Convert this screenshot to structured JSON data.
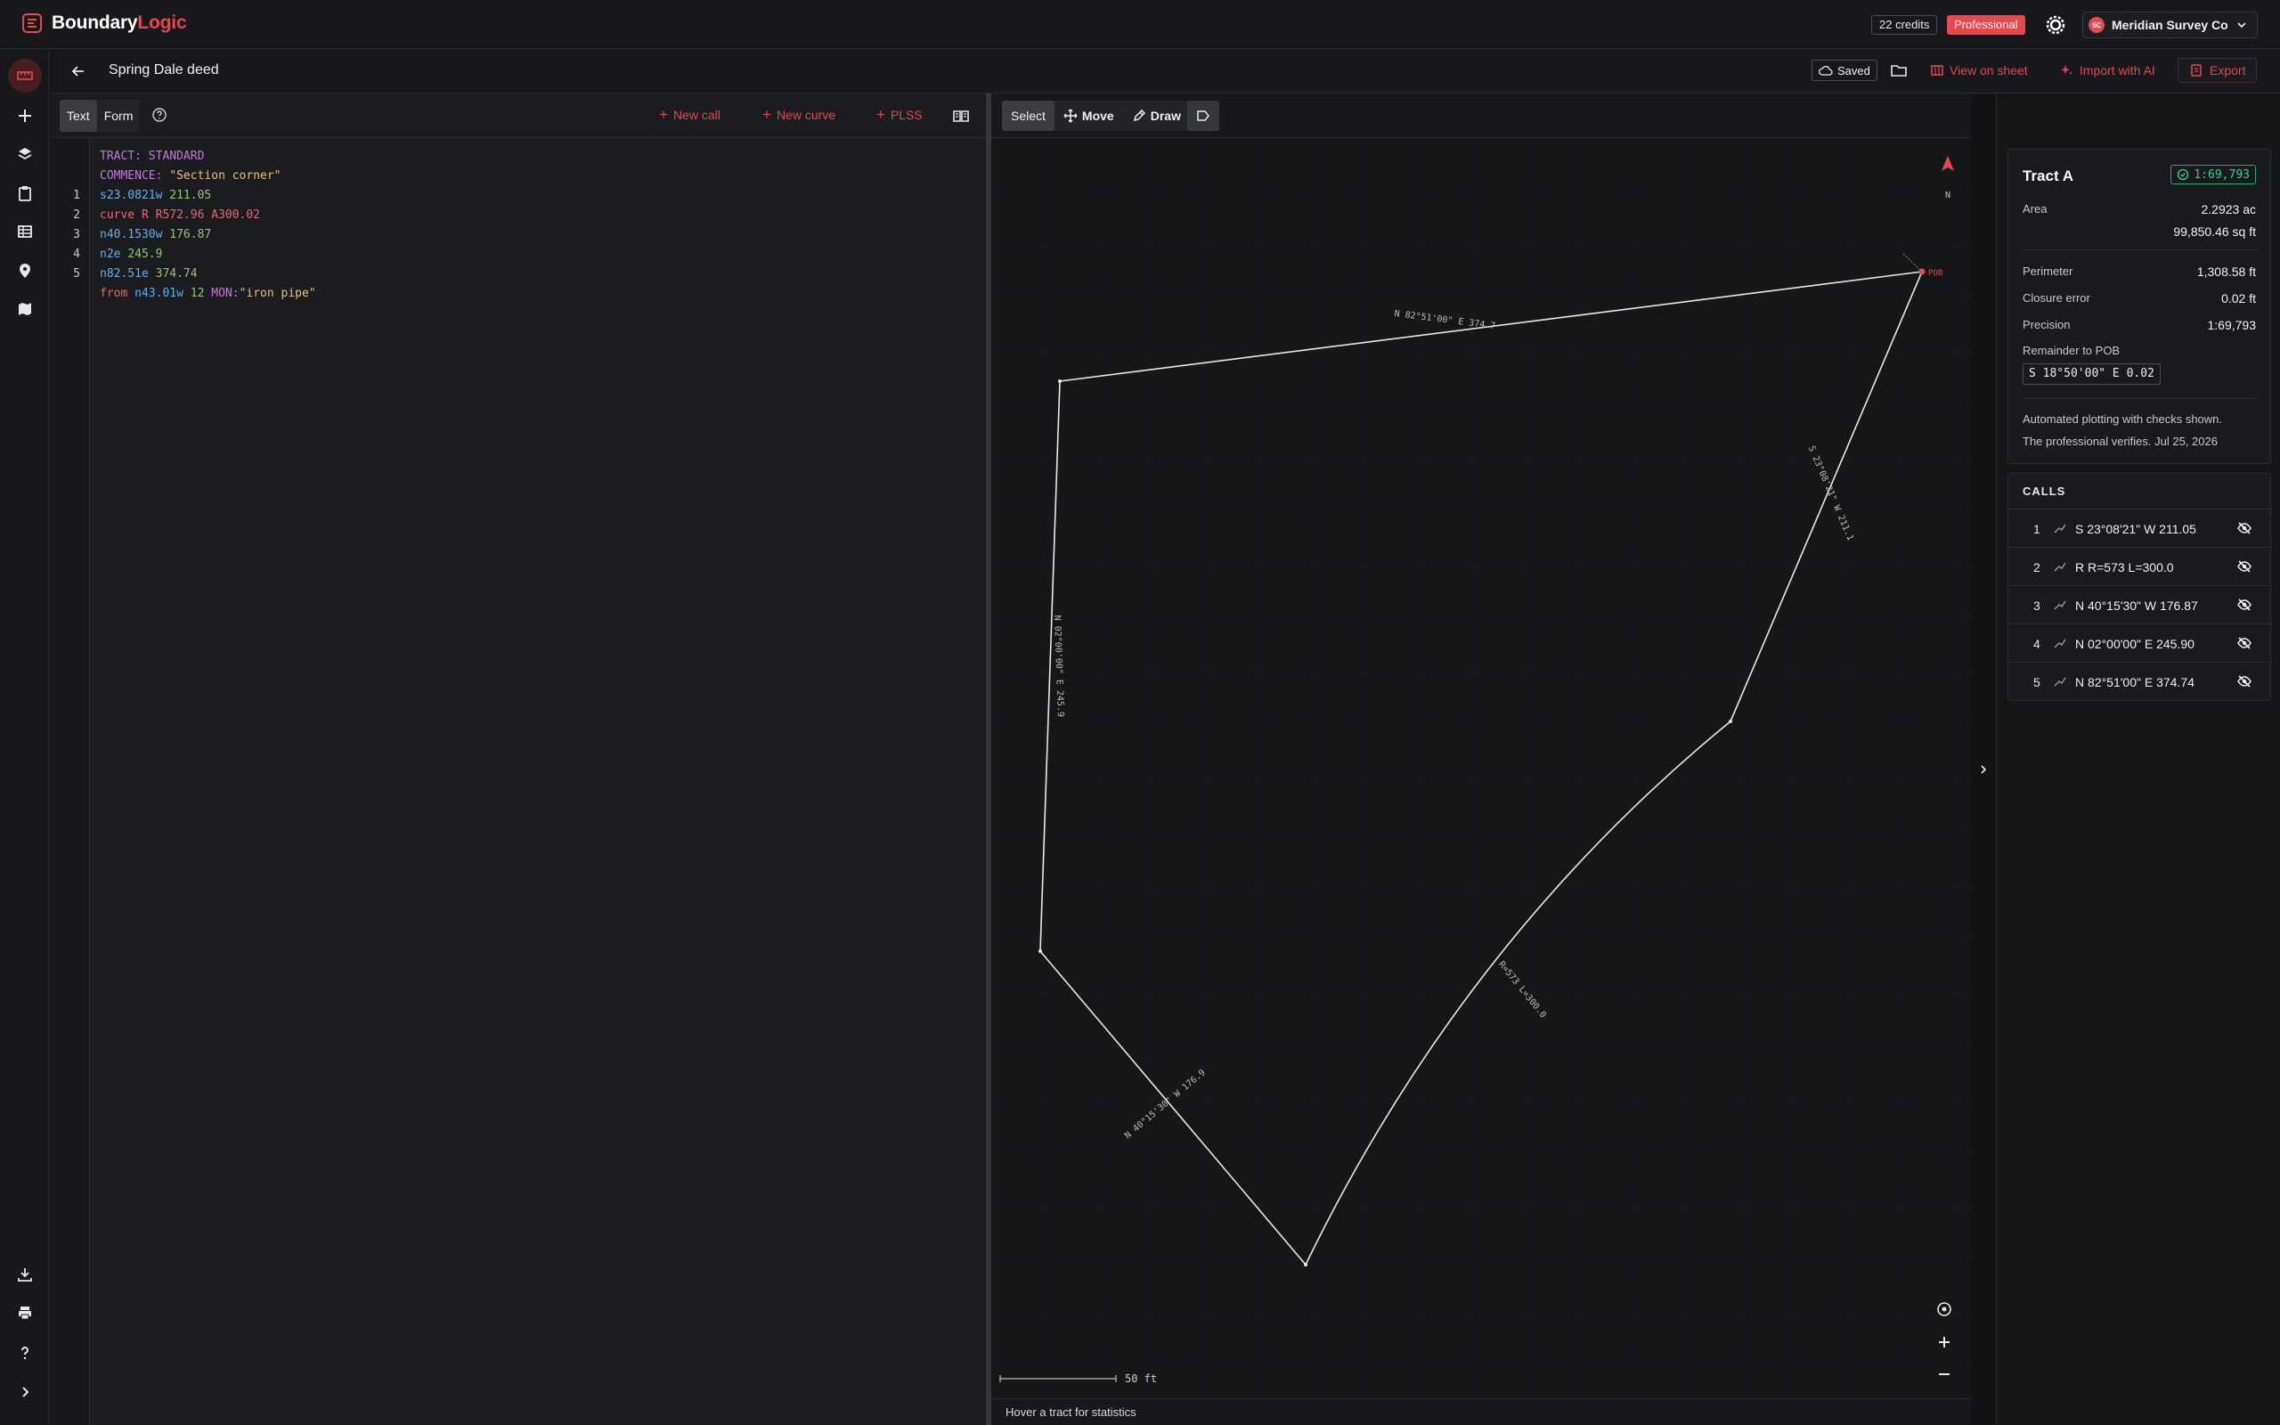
{
  "colors": {
    "accent": "#e5484d",
    "success": "#3ecf8e",
    "background": "#111315",
    "line": "#e8e8e8"
  },
  "topbar": {
    "brand_prefix": "Boundary",
    "brand_suffix": "Logic",
    "credits": "22 credits",
    "plan": "Professional",
    "org_initials": "SC",
    "org_name": "Meridian Survey Co"
  },
  "rail": {
    "top_icons": [
      "ruler-icon",
      "plus-icon",
      "layers-icon",
      "clipboard-icon",
      "table-icon",
      "location-pin-icon",
      "map-icon"
    ],
    "bottom_icons": [
      "download-icon",
      "print-icon",
      "help-icon",
      "chevron-right-icon"
    ]
  },
  "doc": {
    "title": "Spring Dale deed",
    "saved": "Saved",
    "view_on_sheet": "View on sheet",
    "import_ai": "Import with AI",
    "export": "Export"
  },
  "editor": {
    "tabs": [
      {
        "label": "Text",
        "active": true
      },
      {
        "label": "Form",
        "active": false
      }
    ],
    "new_call": "New call",
    "new_curve": "New curve",
    "plss": "PLSS",
    "lines": [
      {
        "num": "",
        "tokens": [
          {
            "t": "TRACT: STANDARD",
            "c": "#c678dd"
          }
        ]
      },
      {
        "num": "",
        "tokens": [
          {
            "t": "COMMENCE: ",
            "c": "#c678dd"
          },
          {
            "t": "\"Section corner\"",
            "c": "#e5c07b"
          }
        ]
      },
      {
        "num": "1",
        "tokens": [
          {
            "t": "s23.0821w ",
            "c": "#61afef"
          },
          {
            "t": "211.05",
            "c": "#98c379"
          }
        ]
      },
      {
        "num": "2",
        "tokens": [
          {
            "t": "curve R R572.96 A300.02",
            "c": "#e06c75"
          }
        ]
      },
      {
        "num": "3",
        "tokens": [
          {
            "t": "n40.1530w ",
            "c": "#61afef"
          },
          {
            "t": "176.87",
            "c": "#98c379"
          }
        ]
      },
      {
        "num": "4",
        "tokens": [
          {
            "t": "n2e ",
            "c": "#61afef"
          },
          {
            "t": "245.9",
            "c": "#98c379"
          }
        ]
      },
      {
        "num": "5",
        "tokens": [
          {
            "t": "n82.51e ",
            "c": "#61afef"
          },
          {
            "t": "374.74",
            "c": "#98c379"
          }
        ]
      },
      {
        "num": "",
        "tokens": [
          {
            "t": "from ",
            "c": "#e06c75"
          },
          {
            "t": "n43.01w ",
            "c": "#61afef"
          },
          {
            "t": "12 ",
            "c": "#98c379"
          },
          {
            "t": "MON:",
            "c": "#c678dd"
          },
          {
            "t": "\"iron pipe\"",
            "c": "#e5c07b"
          }
        ]
      }
    ]
  },
  "map": {
    "tools": [
      "Select",
      "Move",
      "Draw"
    ],
    "north_label": "N",
    "pob_label": "POB",
    "segment_labels": [
      "N 82°51'00\" E 374.7",
      "S 23°08'21\" W 211.1",
      "R=573 L=300.0",
      "N 40°15'30\" W 176.9",
      "N 02°00'00\" E 245.9"
    ],
    "scale_label": "50 ft",
    "status": "Hover a tract for statistics"
  },
  "stats": {
    "tract_name": "Tract A",
    "precision_badge": "1:69,793",
    "area_label": "Area",
    "area_ac": "2.2923 ac",
    "area_sqft": "99,850.46 sq ft",
    "perimeter_label": "Perimeter",
    "perimeter": "1,308.58 ft",
    "closure_label": "Closure error",
    "closure": "0.02 ft",
    "precision_label": "Precision",
    "precision": "1:69,793",
    "remainder_label": "Remainder to POB",
    "remainder": "S 18°50'00\" E 0.02",
    "note1": "Automated plotting with checks shown.",
    "note2": "The professional verifies. Jul 25, 2026"
  },
  "calls": {
    "title": "CALLS",
    "items": [
      {
        "num": "1",
        "text": "S 23°08'21\" W 211.05"
      },
      {
        "num": "2",
        "text": "R R=573 L=300.0"
      },
      {
        "num": "3",
        "text": "N 40°15'30\" W 176.87"
      },
      {
        "num": "4",
        "text": "N 02°00'00\" E 245.90"
      },
      {
        "num": "5",
        "text": "N 82°51'00\" E 374.74"
      }
    ]
  }
}
